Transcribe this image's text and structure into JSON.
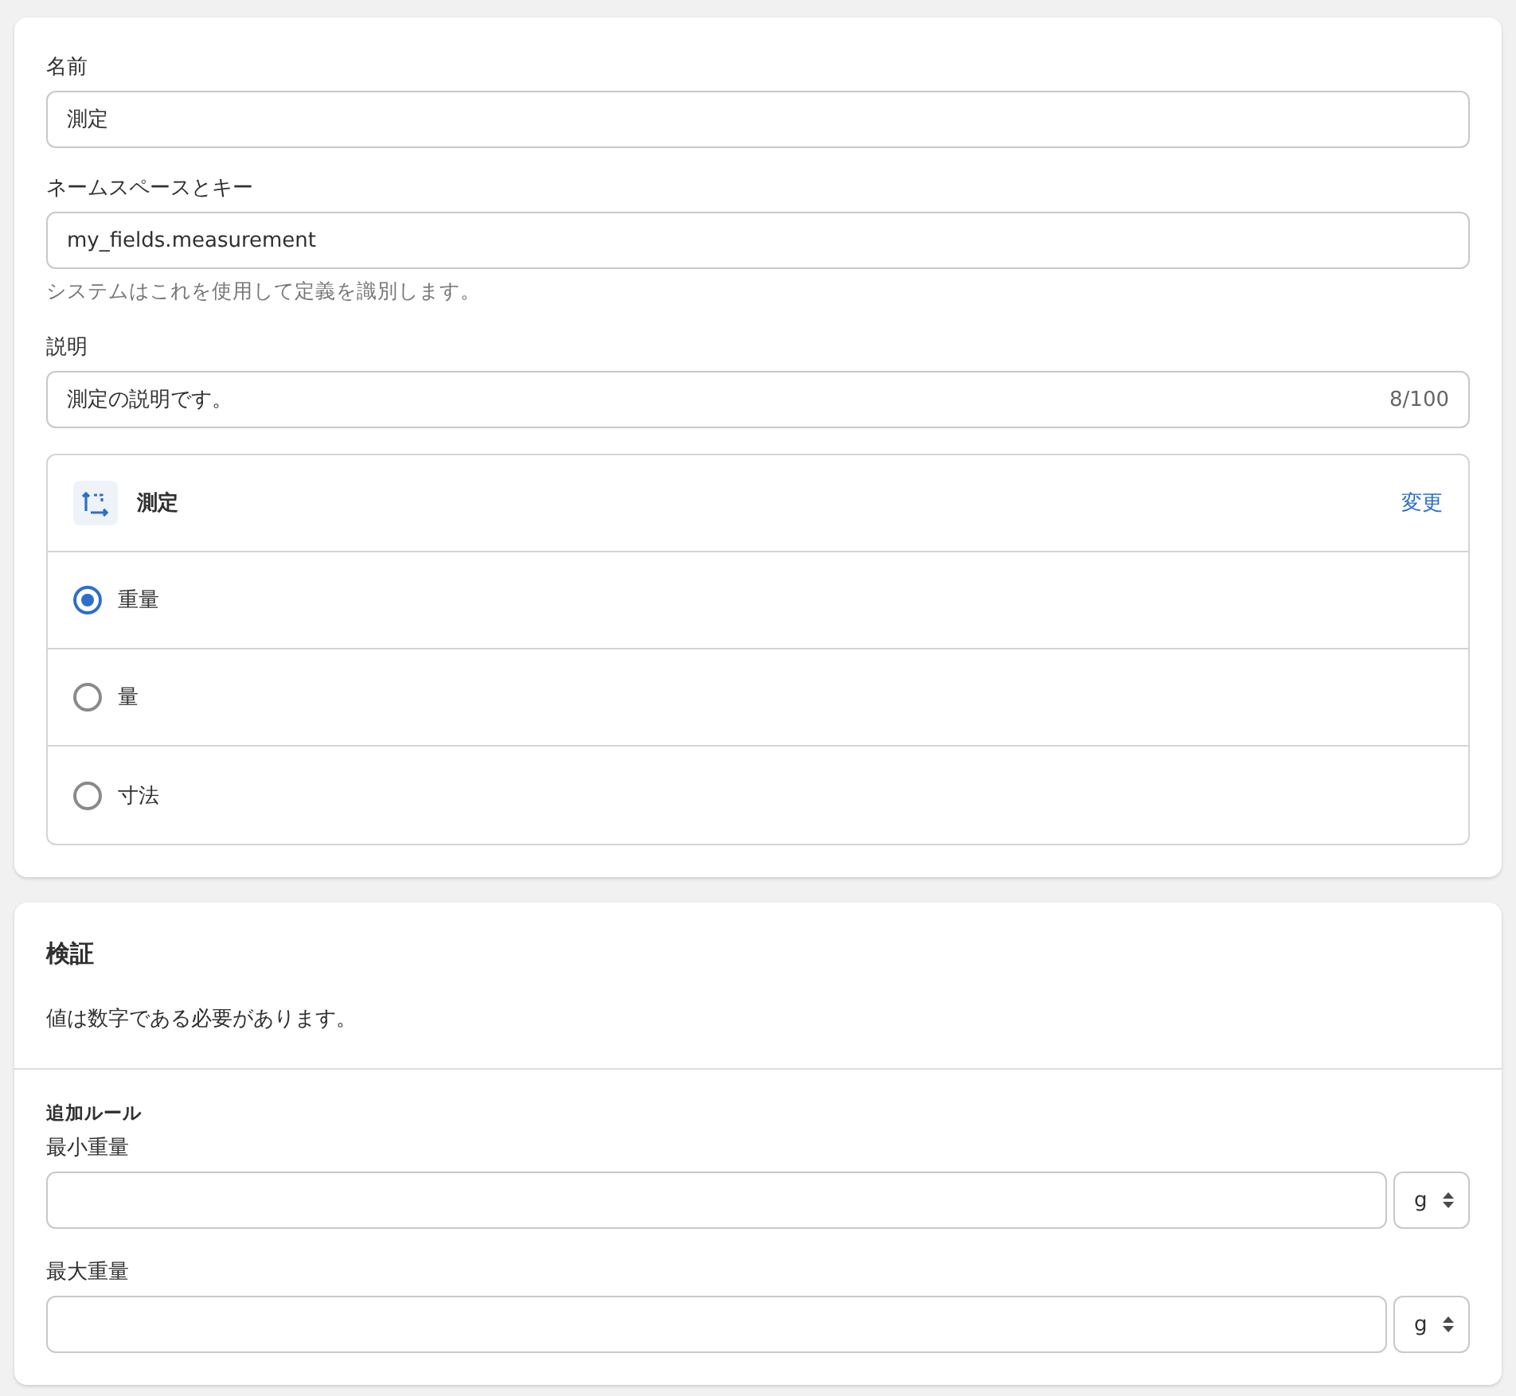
{
  "fields": [
    {
      "label": "名前",
      "value": "測定"
    },
    {
      "label": "ネームスペースとキー",
      "value": "my_fields.measurement",
      "help": "システムはこれを使用して定義を識別します。"
    },
    {
      "label": "説明",
      "value": "測定の説明です。",
      "counter": "8/100"
    }
  ],
  "type_box": {
    "title": "測定",
    "change_link": "変更",
    "options": [
      {
        "label": "重量",
        "selected": true
      },
      {
        "label": "量",
        "selected": false
      },
      {
        "label": "寸法",
        "selected": false
      }
    ]
  },
  "validation": {
    "title": "検証",
    "description": "値は数字である必要があります。",
    "rules_heading": "追加ルール",
    "rules": [
      {
        "label": "最小重量",
        "unit": "g"
      },
      {
        "label": "最大重量",
        "unit": "g"
      }
    ]
  }
}
